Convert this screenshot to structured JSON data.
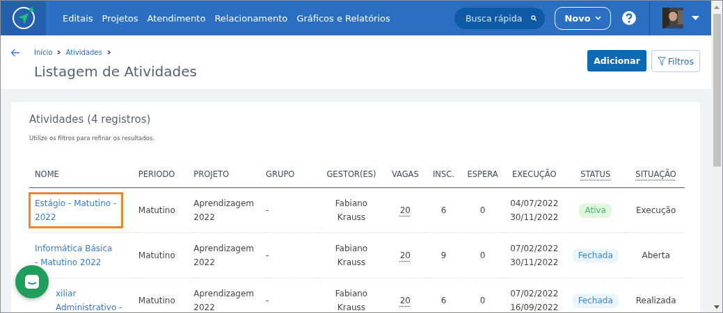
{
  "nav": {
    "items": [
      "Editais",
      "Projetos",
      "Atendimento",
      "Relacionamento",
      "Gráficos e Relatórios"
    ],
    "search": {
      "placeholder": "Busca rápida"
    },
    "new_button": "Novo"
  },
  "header": {
    "breadcrumb": [
      "Início",
      "Atividades"
    ],
    "title": "Listagem de Atividades",
    "buttons": {
      "add": "Adicionar",
      "filters": "Filtros"
    }
  },
  "card": {
    "title": "Atividades (4 registros)",
    "hint": "Utilize os filtros para refinar os resultados.",
    "table": {
      "columns": [
        "NOME",
        "PERIODO",
        "PROJETO",
        "GRUPO",
        "GESTOR(ES)",
        "VAGAS",
        "INSC.",
        "ESPERA",
        "EXECUÇÃO",
        "STATUS",
        "SITUAÇÃO"
      ],
      "rows": [
        {
          "name": "Estágio - Matutino - 2022",
          "highlighted": true,
          "period": "Matutino",
          "project": "Aprendizagem 2022",
          "group": "-",
          "managers": "Fabiano Krauss",
          "vacancies": "20",
          "enrolled": "6",
          "waiting": "0",
          "start": "04/07/2022",
          "end": "30/11/2022",
          "status": {
            "label": "Ativa",
            "kind": "active"
          },
          "situation": "Execução"
        },
        {
          "name": "Informática Básica - Matutino 2022",
          "highlighted": false,
          "period": "Matutino",
          "project": "Aprendizagem 2022",
          "group": "-",
          "managers": "Fabiano Krauss",
          "vacancies": "20",
          "enrolled": "9",
          "waiting": "0",
          "start": "07/02/2022",
          "end": "30/11/2022",
          "status": {
            "label": "Fechada",
            "kind": "closed"
          },
          "situation": "Aberta"
        },
        {
          "name": "xiliar Administrativo -",
          "highlighted": false,
          "period": "Matutino",
          "project": "Aprendizagem 2022",
          "group": "-",
          "managers": "Fabiano Krauss",
          "vacancies": "20",
          "enrolled": "6",
          "waiting": "0",
          "start": "07/02/2022",
          "end": "16/09/2022",
          "status": {
            "label": "Fechada",
            "kind": "closed"
          },
          "situation": "Realizada"
        }
      ]
    }
  }
}
